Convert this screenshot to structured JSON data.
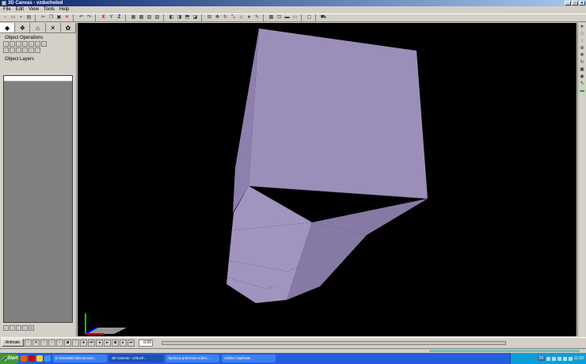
{
  "window": {
    "title": "3D Canvas - vzducholod"
  },
  "menu": [
    "File",
    "Edit",
    "View",
    "Tools",
    "Help"
  ],
  "toolbar": {
    "icons": [
      "new-icon",
      "open-icon",
      "save-icon",
      "print-icon",
      "sep",
      "cut-icon",
      "copy-icon",
      "paste-icon",
      "delete-icon",
      "sep",
      "undo-icon",
      "redo-icon",
      "sep",
      "x-axis-icon",
      "y-axis-icon",
      "z-axis-icon",
      "sep",
      "grid-icon",
      "snap-icon",
      "texture-icon",
      "light-icon",
      "sep",
      "view-front-icon",
      "view-side-icon",
      "view-top-icon",
      "view-persp-icon",
      "sep",
      "move-icon",
      "rotate-icon",
      "scale-icon",
      "camera-icon",
      "light-add-icon",
      "paint-icon",
      "sep",
      "render-icon",
      "wire-icon",
      "sep",
      "monitor-icon",
      "sep",
      "cart-icon"
    ],
    "axis_labels": {
      "x": "X",
      "y": "Y",
      "z": "Z"
    }
  },
  "left_panel": {
    "tabs": [
      "◆",
      "❖",
      "⌂",
      "✕",
      "✿"
    ],
    "object_operations_title": "Object Operations",
    "object_layers_title": "Object Layers"
  },
  "animation_bar": {
    "animate_label": "Animate",
    "time_value": "0.00"
  },
  "taskbar": {
    "start_label": "Start",
    "tasks": [
      {
        "label": "D:\\Skola\\BC\\3DCanvas\\...",
        "active": false
      },
      {
        "label": "3D Canvas - vzduch...",
        "active": true
      },
      {
        "label": "Správca prebrania súbor...",
        "active": false
      },
      {
        "label": "Adobe Captivate",
        "active": false
      }
    ],
    "language": "SK",
    "clock": "11:02"
  },
  "colors": {
    "object_face_top": "#9b8fba",
    "object_face_front": "#a195c0",
    "object_face_dark": "#8679a6",
    "viewport_bg": "#000000"
  }
}
